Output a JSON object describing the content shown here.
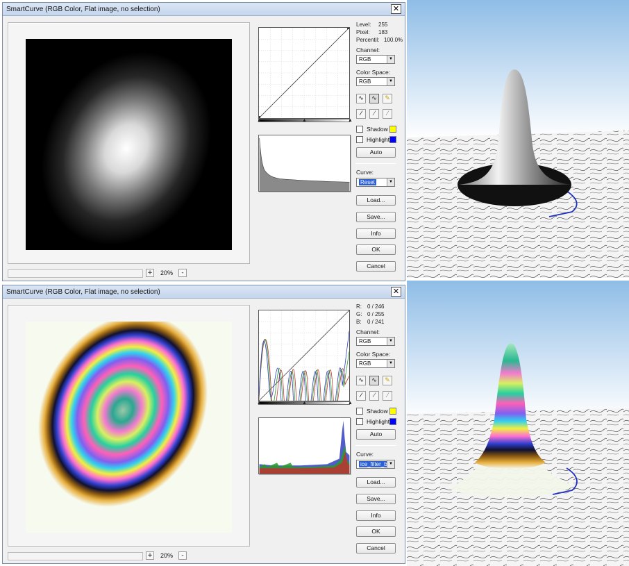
{
  "dialogs": [
    {
      "title": "SmartCurve (RGB Color, Flat image, no selection)",
      "close_glyph": "✕",
      "info": {
        "rows": [
          {
            "label": "Level:",
            "value": "255"
          },
          {
            "label": "Pixel:",
            "value": "183"
          },
          {
            "label": "Percentil:",
            "value": "100.0%"
          }
        ]
      },
      "channel_label": "Channel:",
      "channel_value": "RGB",
      "color_space_label": "Color Space:",
      "color_space_value": "RGB",
      "shadow_label": "Shadow",
      "highlight_label": "Highlight",
      "shadow_color": "#ffff00",
      "highlight_color": "#0000ff",
      "auto_label": "Auto",
      "curve_label": "Curve:",
      "curve_value": "Reset",
      "load_label": "Load...",
      "save_label": "Save...",
      "info_label": "Info",
      "ok_label": "OK",
      "cancel_label": "Cancel",
      "zoom_value": "20%",
      "zoom_in": "+",
      "zoom_out": "-"
    },
    {
      "title": "SmartCurve (RGB Color, Flat image, no selection)",
      "close_glyph": "✕",
      "info": {
        "rows": [
          {
            "label": "R:",
            "value": "0 / 246"
          },
          {
            "label": "G:",
            "value": "0 / 255"
          },
          {
            "label": "B:",
            "value": "0 / 241"
          }
        ]
      },
      "channel_label": "Channel:",
      "channel_value": "RGB",
      "color_space_label": "Color Space:",
      "color_space_value": "RGB",
      "shadow_label": "Shadow",
      "highlight_label": "Highlight",
      "shadow_color": "#ffff00",
      "highlight_color": "#0000ff",
      "auto_label": "Auto",
      "curve_label": "Curve:",
      "curve_value": "ice_filter_be",
      "load_label": "Load...",
      "save_label": "Save...",
      "info_label": "Info",
      "ok_label": "OK",
      "cancel_label": "Cancel",
      "zoom_value": "20%",
      "zoom_in": "+",
      "zoom_out": "-"
    }
  ],
  "icons": [
    "curve-smooth-icon",
    "curve-spline-icon",
    "pencil-icon",
    "eyedropper-black-icon",
    "eyedropper-gray-icon",
    "eyedropper-white-icon"
  ],
  "colors": {
    "sky_top": "#8fbde6",
    "sky_bottom": "#ffffff",
    "title_bar": "#c9d9ee",
    "selection": "#2a5fd6"
  }
}
